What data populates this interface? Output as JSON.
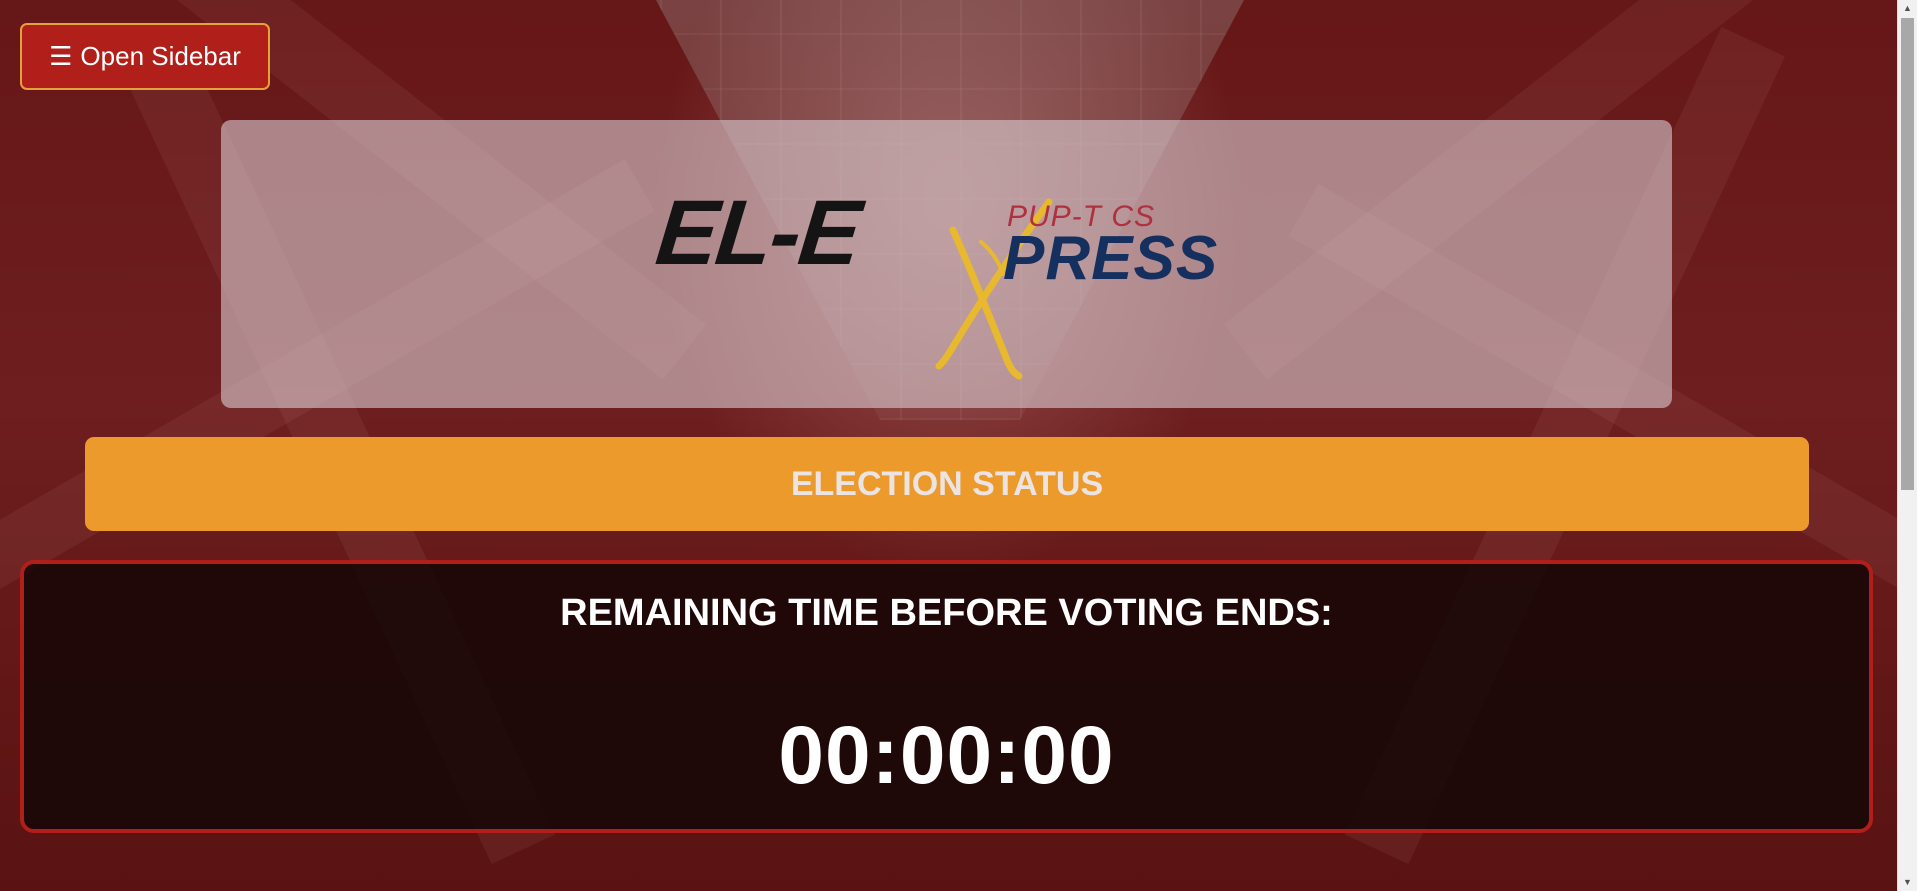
{
  "sidebar_button": {
    "icon": "hamburger-menu-icon",
    "icon_glyph": "☰",
    "label": "Open Sidebar"
  },
  "logo": {
    "main": "EL-E",
    "subtitle": "PUP-T CS",
    "press": "PRESS"
  },
  "status": {
    "title": "ELECTION STATUS"
  },
  "countdown": {
    "label": "REMAINING TIME BEFORE VOTING ENDS:",
    "time": "00:00:00"
  },
  "colors": {
    "accent_orange": "#ec9a2b",
    "accent_red": "#b01f1a",
    "logo_yellow": "#e8b92e",
    "logo_navy": "#15305e"
  }
}
